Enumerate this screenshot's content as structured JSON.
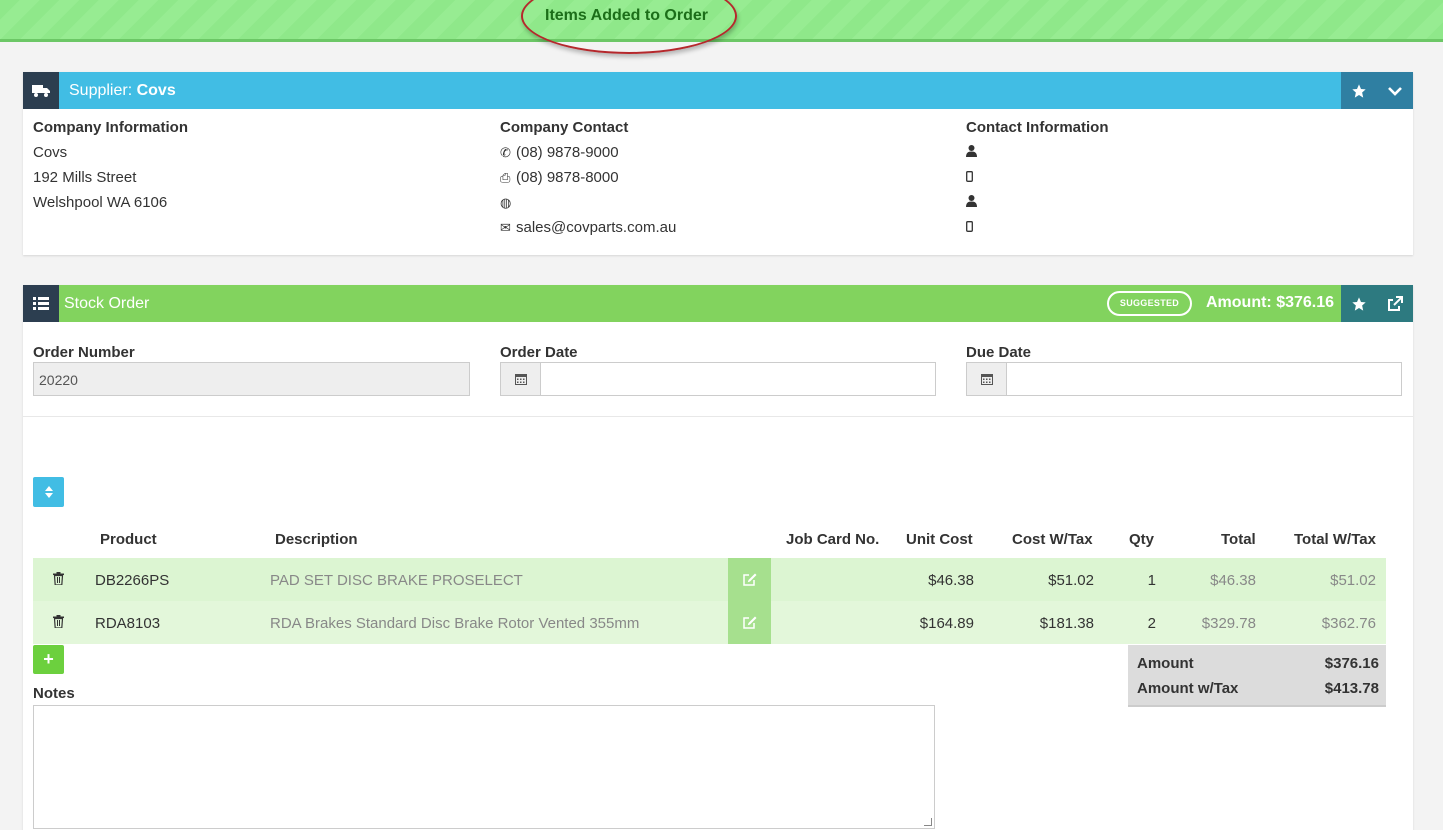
{
  "banner": {
    "text": "Items Added to Order"
  },
  "supplier": {
    "title_prefix": "Supplier: ",
    "title_name": "Covs",
    "company_info": {
      "heading": "Company Information",
      "name": "Covs",
      "address1": "192 Mills Street",
      "address2": "Welshpool WA 6106"
    },
    "company_contact": {
      "heading": "Company Contact",
      "phone": "(08) 9878-9000",
      "fax": "(08) 9878-8000",
      "email": "sales@covparts.com.au"
    },
    "contact_info": {
      "heading": "Contact Information"
    }
  },
  "order": {
    "title": "Stock Order",
    "badge": "SUGGESTED",
    "amount_header": "Amount: $376.16",
    "fields": {
      "order_number_label": "Order Number",
      "order_number_value": "20220",
      "order_date_label": "Order Date",
      "due_date_label": "Due Date"
    },
    "table": {
      "headers": {
        "product": "Product",
        "description": "Description",
        "job_card": "Job Card No.",
        "unit_cost": "Unit Cost",
        "cost_wtax": "Cost W/Tax",
        "qty": "Qty",
        "total": "Total",
        "total_wtax": "Total W/Tax"
      },
      "rows": [
        {
          "product": "DB2266PS",
          "description": "PAD SET DISC BRAKE PROSELECT",
          "job_card": "",
          "unit_cost": "$46.38",
          "cost_wtax": "$51.02",
          "qty": "1",
          "total": "$46.38",
          "total_wtax": "$51.02"
        },
        {
          "product": "RDA8103",
          "description": "RDA Brakes Standard Disc Brake Rotor Vented 355mm",
          "job_card": "",
          "unit_cost": "$164.89",
          "cost_wtax": "$181.38",
          "qty": "2",
          "total": "$329.78",
          "total_wtax": "$362.76"
        }
      ]
    },
    "totals": {
      "amount_label": "Amount",
      "amount_value": "$376.16",
      "amount_wtax_label": "Amount w/Tax",
      "amount_wtax_value": "$413.78"
    },
    "notes_label": "Notes",
    "add_label": "+"
  },
  "icons": {
    "truck": "truck-icon",
    "star": "star-icon",
    "chevron": "chevron-down-icon",
    "list": "list-icon",
    "external": "external-link-icon",
    "phone": "phone-icon",
    "print": "print-icon",
    "globe": "globe-icon",
    "envelope": "envelope-icon",
    "user": "user-icon",
    "mobile": "mobile-icon",
    "calendar": "calendar-icon",
    "sort": "sort-icon",
    "trash": "trash-icon",
    "edit": "edit-icon"
  },
  "colors": {
    "banner_bg": "#8fe88a",
    "banner_text": "#1c6e19",
    "supplier_header": "#41bde4",
    "order_header": "#82d35e",
    "row_bg": "#dcf5d2",
    "accent_dark": "#2c3e50"
  }
}
